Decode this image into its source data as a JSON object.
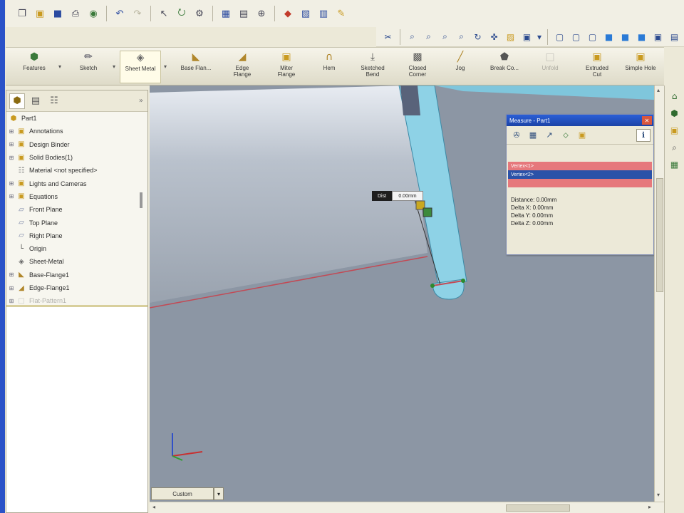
{
  "icons": {
    "std_toolbar": [
      "new-icon",
      "open-icon",
      "save-icon",
      "print-icon",
      "save-all-icon",
      "undo-icon",
      "redo-icon",
      "select-icon",
      "rebuild-icon",
      "options-icon",
      "appearance-icon",
      "view-orientation-icon",
      "zoom-icon",
      "help-icon"
    ],
    "view_toolbar": [
      "measure-icon",
      "zoom-to-fit-icon",
      "zoom-to-area-icon",
      "previous-view-icon",
      "zoom-in-out-icon",
      "rotate-icon",
      "pan-icon",
      "section-view-icon",
      "standard-views-icon",
      "wireframe-icon",
      "hidden-lines-icon",
      "shaded-edges-icon",
      "shaded-icon",
      "shadows-icon",
      "perspective-icon"
    ]
  },
  "command_manager": {
    "buttons": [
      {
        "label": "Features",
        "icon": "features-icon"
      },
      {
        "label": "Sketch",
        "icon": "sketch-icon"
      },
      {
        "label": "Sheet Metal",
        "icon": "sheet-metal-icon"
      },
      {
        "label": "Base Flan...",
        "icon": "base-flange-icon"
      },
      {
        "label": "Edge\nFlange",
        "icon": "edge-flange-icon"
      },
      {
        "label": "Miter\nFlange",
        "icon": "miter-flange-icon"
      },
      {
        "label": "Hem",
        "icon": "hem-icon"
      },
      {
        "label": "Sketched\nBend",
        "icon": "sketched-bend-icon"
      },
      {
        "label": "Closed\nCorner",
        "icon": "closed-corner-icon"
      },
      {
        "label": "Jog",
        "icon": "jog-icon"
      },
      {
        "label": "Break Co...",
        "icon": "break-corner-icon"
      },
      {
        "label": "Unfold",
        "icon": "unfold-icon"
      },
      {
        "label": "Extruded\nCut",
        "icon": "extruded-cut-icon"
      },
      {
        "label": "Simple Hole",
        "icon": "simple-hole-icon"
      }
    ]
  },
  "feature_tree": {
    "root": "Part1",
    "items": [
      {
        "label": "Annotations",
        "expandable": true,
        "icon": "annotations-icon"
      },
      {
        "label": "Design Binder",
        "expandable": true,
        "icon": "design-binder-icon"
      },
      {
        "label": "Solid Bodies(1)",
        "expandable": true,
        "icon": "solid-bodies-icon"
      },
      {
        "label": "Material <not specified>",
        "expandable": false,
        "icon": "material-icon"
      },
      {
        "label": "Lights and Cameras",
        "expandable": true,
        "icon": "lights-icon"
      },
      {
        "label": "Equations",
        "expandable": true,
        "icon": "equations-icon"
      },
      {
        "label": "Front Plane",
        "expandable": false,
        "icon": "plane-icon"
      },
      {
        "label": "Top Plane",
        "expandable": false,
        "icon": "plane-icon"
      },
      {
        "label": "Right Plane",
        "expandable": false,
        "icon": "plane-icon"
      },
      {
        "label": "Origin",
        "expandable": false,
        "icon": "origin-icon"
      },
      {
        "label": "Sheet-Metal",
        "expandable": false,
        "icon": "sheet-metal-feature-icon"
      },
      {
        "label": "Base-Flange1",
        "expandable": true,
        "icon": "base-flange-feature-icon"
      },
      {
        "label": "Edge-Flange1",
        "expandable": true,
        "icon": "edge-flange-feature-icon"
      },
      {
        "label": "Flat-Pattern1",
        "expandable": true,
        "icon": "flat-pattern-icon",
        "faded": true
      }
    ]
  },
  "measure_dialog": {
    "title": "Measure - Part1",
    "selections": [
      "Vertex<1>",
      "Vertex<2>",
      ""
    ],
    "results": [
      "Distance: 0.00mm",
      "Delta X: 0.00mm",
      "Delta Y: 0.00mm",
      "Delta Z: 0.00mm"
    ]
  },
  "viewport": {
    "tooltip_label": "Dist",
    "tooltip_value": "0.00mm",
    "view_tab": "Custom"
  },
  "colors": {
    "viewport_bg": "#8c96a4",
    "flange_face": "#8ed2e6",
    "dialog_title": "#2a5fd6",
    "selection_red": "#e6787c",
    "selection_blue": "#2b52a8"
  }
}
